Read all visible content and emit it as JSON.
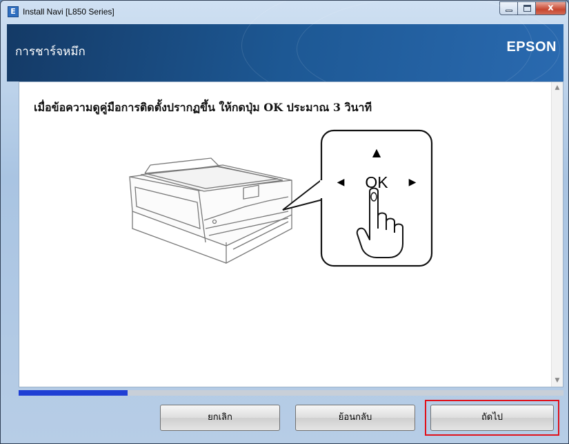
{
  "window": {
    "title": "Install Navi [L850 Series]",
    "icon_name": "epson-app-icon",
    "icon_letter": "E",
    "controls": {
      "minimize": "minimize",
      "maximize": "maximize",
      "close": "x"
    }
  },
  "header": {
    "title": "การชาร์จหมึก",
    "brand": "EPSON",
    "background_color": "#1d5894"
  },
  "content": {
    "instruction": "เมื่อข้อความดูคู่มือการติดตั้งปรากฏขึ้น ให้กดปุ่ม OK ประมาณ 3 วินาที",
    "illustration": {
      "description_icon": "printer-illustration",
      "panel_key_label": "OK",
      "arrow_up": "▲",
      "arrow_left": "◀",
      "arrow_right": "▶"
    }
  },
  "progress": {
    "value_percent": 20,
    "color": "#1f3fd4"
  },
  "buttons": {
    "cancel": "ยกเลิก",
    "back": "ย้อนกลับ",
    "next": "ถัดไป"
  },
  "highlight_color": "#e0101a"
}
